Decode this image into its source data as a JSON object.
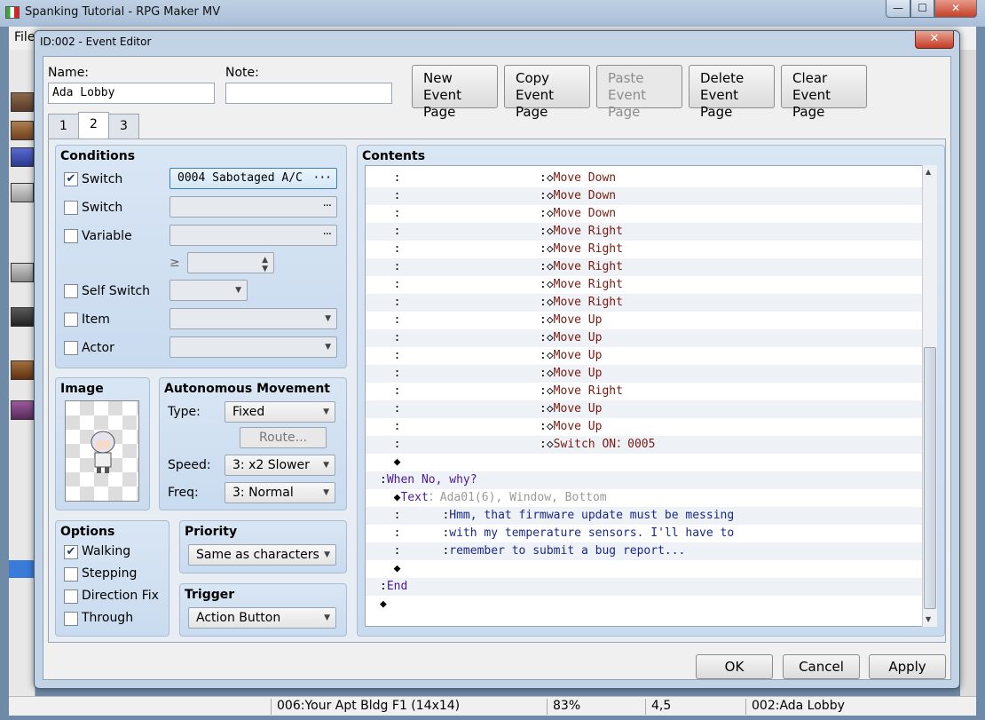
{
  "app": {
    "title": "Spanking Tutorial - RPG Maker MV",
    "menu_file": "File",
    "min": "—",
    "max": "☐",
    "close": "✕"
  },
  "statusbar": {
    "map": "006:Your Apt Bldg F1 (14x14)",
    "zoom": "83%",
    "coords": "4,5",
    "event": "002:Ada Lobby"
  },
  "dialog": {
    "title": "ID:002 - Event Editor",
    "close": "✕",
    "name_label": "Name:",
    "name_value": "Ada Lobby",
    "note_label": "Note:",
    "note_value": "",
    "toolbar": [
      {
        "l1": "New",
        "l2": "Event Page"
      },
      {
        "l1": "Copy",
        "l2": "Event Page"
      },
      {
        "l1": "Paste",
        "l2": "Event Page"
      },
      {
        "l1": "Delete",
        "l2": "Event Page"
      },
      {
        "l1": "Clear",
        "l2": "Event Page"
      }
    ],
    "tabs": [
      "1",
      "2",
      "3"
    ],
    "conditions": {
      "title": "Conditions",
      "switch1_label": "Switch",
      "switch1_value": "0004 Sabotaged A/C",
      "switch2_label": "Switch",
      "variable_label": "Variable",
      "gte": "≥",
      "self_switch_label": "Self Switch",
      "item_label": "Item",
      "actor_label": "Actor",
      "ellipsis": "···"
    },
    "image": {
      "title": "Image"
    },
    "autonomous": {
      "title": "Autonomous Movement",
      "type_label": "Type:",
      "type_value": "Fixed",
      "route_button": "Route...",
      "speed_label": "Speed:",
      "speed_value": "3: x2 Slower",
      "freq_label": "Freq:",
      "freq_value": "3: Normal"
    },
    "options": {
      "title": "Options",
      "walking": "Walking",
      "stepping": "Stepping",
      "direction_fix": "Direction Fix",
      "through": "Through"
    },
    "priority": {
      "title": "Priority",
      "value": "Same as characters"
    },
    "trigger": {
      "title": "Trigger",
      "value": "Action Button"
    },
    "contents": {
      "title": "Contents",
      "rows": [
        {
          "indent": "  :                    :",
          "dia": "◇",
          "text": "Move Down",
          "cls": "c-green"
        },
        {
          "indent": "  :                    :",
          "dia": "◇",
          "text": "Move Down",
          "cls": "c-green"
        },
        {
          "indent": "  :                    :",
          "dia": "◇",
          "text": "Move Down",
          "cls": "c-green"
        },
        {
          "indent": "  :                    :",
          "dia": "◇",
          "text": "Move Right",
          "cls": "c-green"
        },
        {
          "indent": "  :                    :",
          "dia": "◇",
          "text": "Move Right",
          "cls": "c-green"
        },
        {
          "indent": "  :                    :",
          "dia": "◇",
          "text": "Move Right",
          "cls": "c-green"
        },
        {
          "indent": "  :                    :",
          "dia": "◇",
          "text": "Move Right",
          "cls": "c-green"
        },
        {
          "indent": "  :                    :",
          "dia": "◇",
          "text": "Move Right",
          "cls": "c-green"
        },
        {
          "indent": "  :                    :",
          "dia": "◇",
          "text": "Move Up",
          "cls": "c-green"
        },
        {
          "indent": "  :                    :",
          "dia": "◇",
          "text": "Move Up",
          "cls": "c-green"
        },
        {
          "indent": "  :                    :",
          "dia": "◇",
          "text": "Move Up",
          "cls": "c-green"
        },
        {
          "indent": "  :                    :",
          "dia": "◇",
          "text": "Move Up",
          "cls": "c-green"
        },
        {
          "indent": "  :                    :",
          "dia": "◇",
          "text": "Move Right",
          "cls": "c-green"
        },
        {
          "indent": "  :                    :",
          "dia": "◇",
          "text": "Move Up",
          "cls": "c-green"
        },
        {
          "indent": "  :                    :",
          "dia": "◇",
          "text": "Move Up",
          "cls": "c-green"
        },
        {
          "indent": "  :                    :",
          "dia": "◇",
          "text": "Switch ON：0005",
          "cls": "c-green"
        },
        {
          "indent": "  ",
          "dia": "◆",
          "text": "",
          "cls": "c-dia"
        },
        {
          "indent": ":",
          "dia": "",
          "text": "When No, why?",
          "cls": "c-purple"
        },
        {
          "indent": "  ",
          "dia": "◆",
          "text": "Text",
          "cls": "c-purple",
          "extra": "：Ada01(6), Window, Bottom"
        },
        {
          "indent": "  :      :",
          "dia": "",
          "text": "Hmm, that firmware update must be messing",
          "cls": "c-navy"
        },
        {
          "indent": "  :      :",
          "dia": "",
          "text": "with my temperature sensors. I'll have to",
          "cls": "c-navy"
        },
        {
          "indent": "  :      :",
          "dia": "",
          "text": "remember to submit a bug report...",
          "cls": "c-navy"
        },
        {
          "indent": "  ",
          "dia": "◆",
          "text": "",
          "cls": "c-dia"
        },
        {
          "indent": ":",
          "dia": "",
          "text": "End",
          "cls": "c-purple"
        },
        {
          "indent": "",
          "dia": "◆",
          "text": "",
          "cls": "c-dia"
        }
      ]
    },
    "buttons": {
      "ok": "OK",
      "cancel": "Cancel",
      "apply": "Apply"
    }
  }
}
